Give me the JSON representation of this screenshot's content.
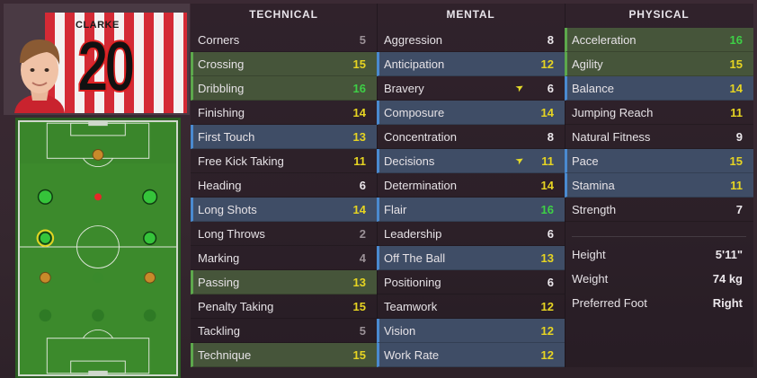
{
  "player": {
    "shirt_name": "CLARKE",
    "shirt_number": "20"
  },
  "columns": {
    "technical": {
      "title": "TECHNICAL",
      "rows": [
        {
          "name": "Corners",
          "value": "5",
          "tone": "grey",
          "hl": ""
        },
        {
          "name": "Crossing",
          "value": "15",
          "tone": "yellow",
          "hl": "green"
        },
        {
          "name": "Dribbling",
          "value": "16",
          "tone": "green",
          "hl": "green"
        },
        {
          "name": "Finishing",
          "value": "14",
          "tone": "yellow",
          "hl": ""
        },
        {
          "name": "First Touch",
          "value": "13",
          "tone": "yellow",
          "hl": "blue"
        },
        {
          "name": "Free Kick Taking",
          "value": "11",
          "tone": "yellow",
          "hl": ""
        },
        {
          "name": "Heading",
          "value": "6",
          "tone": "white",
          "hl": ""
        },
        {
          "name": "Long Shots",
          "value": "14",
          "tone": "yellow",
          "hl": "blue"
        },
        {
          "name": "Long Throws",
          "value": "2",
          "tone": "grey",
          "hl": ""
        },
        {
          "name": "Marking",
          "value": "4",
          "tone": "grey",
          "hl": ""
        },
        {
          "name": "Passing",
          "value": "13",
          "tone": "yellow",
          "hl": "green"
        },
        {
          "name": "Penalty Taking",
          "value": "15",
          "tone": "yellow",
          "hl": ""
        },
        {
          "name": "Tackling",
          "value": "5",
          "tone": "grey",
          "hl": ""
        },
        {
          "name": "Technique",
          "value": "15",
          "tone": "yellow",
          "hl": "green"
        }
      ]
    },
    "mental": {
      "title": "MENTAL",
      "rows": [
        {
          "name": "Aggression",
          "value": "8",
          "tone": "white",
          "hl": "",
          "arrow": false
        },
        {
          "name": "Anticipation",
          "value": "12",
          "tone": "yellow",
          "hl": "blue",
          "arrow": false
        },
        {
          "name": "Bravery",
          "value": "6",
          "tone": "white",
          "hl": "",
          "arrow": true
        },
        {
          "name": "Composure",
          "value": "14",
          "tone": "yellow",
          "hl": "blue",
          "arrow": false
        },
        {
          "name": "Concentration",
          "value": "8",
          "tone": "white",
          "hl": "",
          "arrow": false
        },
        {
          "name": "Decisions",
          "value": "11",
          "tone": "yellow",
          "hl": "blue",
          "arrow": true
        },
        {
          "name": "Determination",
          "value": "14",
          "tone": "yellow",
          "hl": "",
          "arrow": false
        },
        {
          "name": "Flair",
          "value": "16",
          "tone": "green",
          "hl": "blue",
          "arrow": false
        },
        {
          "name": "Leadership",
          "value": "6",
          "tone": "white",
          "hl": "",
          "arrow": false
        },
        {
          "name": "Off The Ball",
          "value": "13",
          "tone": "yellow",
          "hl": "blue",
          "arrow": false
        },
        {
          "name": "Positioning",
          "value": "6",
          "tone": "white",
          "hl": "",
          "arrow": false
        },
        {
          "name": "Teamwork",
          "value": "12",
          "tone": "yellow",
          "hl": "",
          "arrow": false
        },
        {
          "name": "Vision",
          "value": "12",
          "tone": "yellow",
          "hl": "blue",
          "arrow": false
        },
        {
          "name": "Work Rate",
          "value": "12",
          "tone": "yellow",
          "hl": "blue",
          "arrow": false
        }
      ]
    },
    "physical": {
      "title": "PHYSICAL",
      "rows": [
        {
          "name": "Acceleration",
          "value": "16",
          "tone": "green",
          "hl": "green"
        },
        {
          "name": "Agility",
          "value": "15",
          "tone": "yellow",
          "hl": "green"
        },
        {
          "name": "Balance",
          "value": "14",
          "tone": "yellow",
          "hl": "blue"
        },
        {
          "name": "Jumping Reach",
          "value": "11",
          "tone": "yellow",
          "hl": ""
        },
        {
          "name": "Natural Fitness",
          "value": "9",
          "tone": "white",
          "hl": ""
        },
        {
          "name": "Pace",
          "value": "15",
          "tone": "yellow",
          "hl": "blue"
        },
        {
          "name": "Stamina",
          "value": "11",
          "tone": "yellow",
          "hl": "blue"
        },
        {
          "name": "Strength",
          "value": "7",
          "tone": "white",
          "hl": ""
        }
      ],
      "info": [
        {
          "name": "Height",
          "value": "5'11\""
        },
        {
          "name": "Weight",
          "value": "74 kg"
        },
        {
          "name": "Preferred Foot",
          "value": "Right"
        }
      ]
    }
  },
  "colors": {
    "grey": "#9b9197",
    "white": "#ece8ec",
    "yellow": "#e6d422",
    "green": "#3ed046",
    "pitch": "#3c8a2c"
  }
}
